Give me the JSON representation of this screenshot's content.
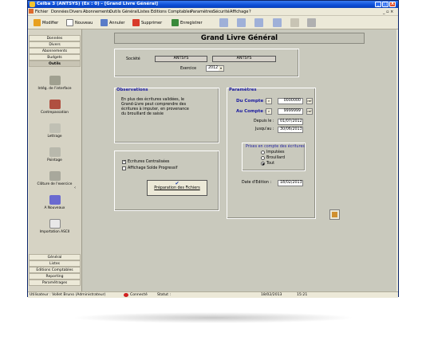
{
  "window": {
    "title": "Ceiba 3 (ANTSYS) (Ex : 0) - [Grand Livre Général]",
    "min_label": "_",
    "max_label": "□",
    "close_label": "X",
    "mdi_controls": "_ ▫ ×"
  },
  "menu": [
    "Fichier",
    "Données",
    "Divers",
    "Abonnements",
    "Outils",
    "Général",
    "Listes",
    "Editions Comptables",
    "Paramètres",
    "Sécurité",
    "Affichage",
    "?"
  ],
  "toolbar": {
    "modifier": "Modifier",
    "nouveau": "Nouveau",
    "annuler": "Annuler",
    "supprimer": "Supprimer",
    "enregistrer": "Enregistrer"
  },
  "sidebar": {
    "top_tabs": [
      "Données",
      "Divers",
      "Abonnements",
      "Budgets",
      "Outils"
    ],
    "items": [
      "Intég. de l'interface",
      "Contrepassation",
      "Lettrage",
      "Pointage",
      "Clôture de l'exercice",
      "A Nouveaux",
      "Importation ASCII"
    ],
    "bottom_tabs": [
      "Général",
      "Listes",
      "Editions Comptables",
      "Reporting",
      "Paramétrages"
    ],
    "collapse_arrow": "‹"
  },
  "main": {
    "heading": "Grand Livre Général",
    "societe_label": "Société",
    "societe_code": "ANTSYS",
    "societe_name": "ANTSYS",
    "exercice_label": "Exercice",
    "exercice_value": "2012",
    "observations_title": "Observations",
    "observations_text": [
      "En plus des écritures validées, le",
      "Grand-Livre peut comprendre des",
      "écritures à imputer, en provenance",
      "du brouillard de saisie"
    ],
    "parametres_title": "Paramètres",
    "du_compte_label": "Du Compte :",
    "du_compte_value": "0000000",
    "au_compte_label": "Au Compte :",
    "au_compte_value": "9999999",
    "ref_label": "ref",
    "depuis_label": "Depuis le :",
    "depuis_value": "01/07/2012",
    "jusquau_label": "Jusqu'au :",
    "jusquau_value": "30/06/2013",
    "prises_title": "Prises en compte des écritures",
    "prises_options": [
      "Imputées",
      "Brouillard",
      "Tout"
    ],
    "ecritures_centralisees": "Ecritures Centralisées",
    "affichage_solde": "Affichage Solde Progressif",
    "preparation_label": "Préparation des Fichiers",
    "date_edition_label": "Date d'Edition :",
    "date_edition_value": "18/02/2013"
  },
  "status": {
    "user": "Utilisateur : Vollet Bruno (Administrateur)",
    "connected": "Connecté",
    "statut": "Statut :",
    "date": "18/02/2013",
    "time": "15:21"
  },
  "colors": {
    "title_bar": "#0b4dd6",
    "form_bg": "#c9c9bd",
    "section_blue": "#1a1aa0",
    "close_red": "#e0502d"
  }
}
